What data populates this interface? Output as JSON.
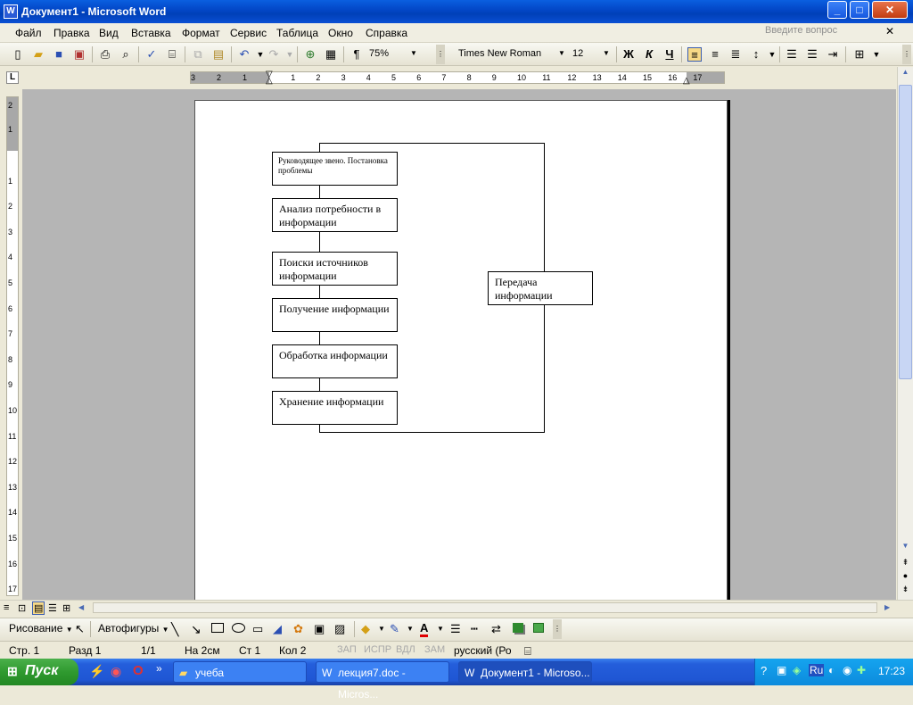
{
  "window": {
    "title": "Документ1 - Microsoft Word",
    "app_icon": "W",
    "minimize": "_",
    "maximize": "□",
    "close": "✕"
  },
  "menu": {
    "items": [
      "Файл",
      "Правка",
      "Вид",
      "Вставка",
      "Формат",
      "Сервис",
      "Таблица",
      "Окно",
      "Справка"
    ],
    "ask_placeholder": "Введите вопрос",
    "close_doc": "✕"
  },
  "toolbar": {
    "zoom": "75%",
    "font_name": "Times New Roman",
    "font_size": "12",
    "bold": "Ж",
    "italic": "К",
    "underline": "Ч",
    "show_marks": "¶"
  },
  "ruler": {
    "corner": "L",
    "h_ticks": [
      "3",
      "2",
      "1",
      "1",
      "2",
      "3",
      "4",
      "5",
      "6",
      "7",
      "8",
      "9",
      "10",
      "11",
      "12",
      "13",
      "14",
      "15",
      "16",
      "17"
    ],
    "v_ticks": [
      "2",
      "1",
      "1",
      "2",
      "3",
      "4",
      "5",
      "6",
      "7",
      "8",
      "9",
      "10",
      "11",
      "12",
      "13",
      "14",
      "15",
      "16",
      "17"
    ]
  },
  "diagram": {
    "boxes": [
      "Руководящее звено. Постановка проблемы",
      "Анализ потребности в информации",
      "Поиски источников информации",
      "Получение информации",
      "Обработка информации",
      "Хранение информации"
    ],
    "transfer": "Передача информации"
  },
  "drawbar": {
    "drawing": "Рисование",
    "autoshapes": "Автофигуры"
  },
  "status": {
    "page": "Стр.   1",
    "section": "Разд  1",
    "pages": "1/1",
    "at": "На  2см",
    "line": "Ст  1",
    "col": "Кол  2",
    "rec": "ЗАП",
    "trk": "ИСПР",
    "ext": "ВДЛ",
    "ovr": "ЗАМ",
    "lang": "русский (Ро"
  },
  "taskbar": {
    "start": "Пуск",
    "tasks": [
      "учеба",
      "лекция7.doc - Micros...",
      "Документ1 - Microso..."
    ],
    "lang": "Ru",
    "time": "17:23"
  },
  "colors": {
    "titlebar": "#0348c8",
    "taskbar": "#245edb",
    "start": "#2f9a2f"
  }
}
